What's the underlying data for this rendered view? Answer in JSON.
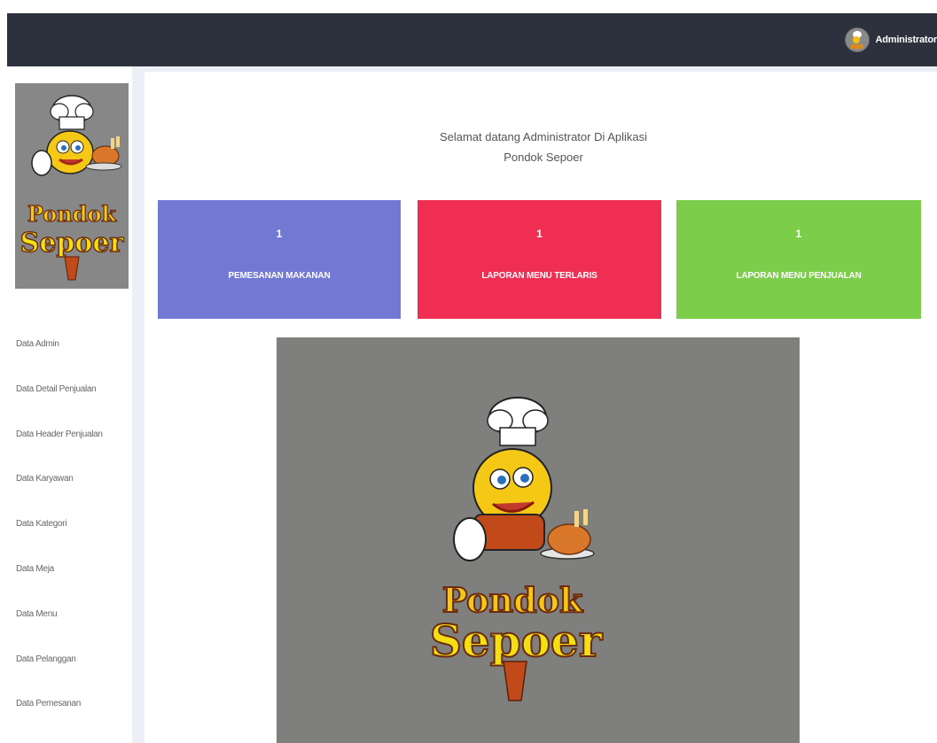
{
  "header": {
    "user_name": "Administrator",
    "avatar_icon": "user-avatar-icon"
  },
  "brand": {
    "logo_line1": "Pondok",
    "logo_line2": "Sepoer"
  },
  "sidebar": {
    "items": [
      {
        "label": "Data Admin"
      },
      {
        "label": "Data Detail Penjualan"
      },
      {
        "label": "Data Header Penjualan"
      },
      {
        "label": "Data Karyawan"
      },
      {
        "label": "Data Kategori"
      },
      {
        "label": "Data Meja"
      },
      {
        "label": "Data Menu"
      },
      {
        "label": "Data Pelanggan"
      },
      {
        "label": "Data Pemesanan"
      }
    ]
  },
  "main": {
    "welcome_line1": "Selamat datang Administrator Di Aplikasi",
    "welcome_line2": "Pondok Sepoer",
    "cards": [
      {
        "count": "1",
        "label": "PEMESANAN MAKANAN",
        "color": "#7179d2"
      },
      {
        "count": "1",
        "label": "LAPORAN MENU TERLARIS",
        "color": "#f02d52"
      },
      {
        "count": "1",
        "label": "LAPORAN MENU PENJUALAN",
        "color": "#7ccd49"
      }
    ]
  },
  "colors": {
    "topbar": "#2d313e",
    "logo_background": "#878787"
  }
}
